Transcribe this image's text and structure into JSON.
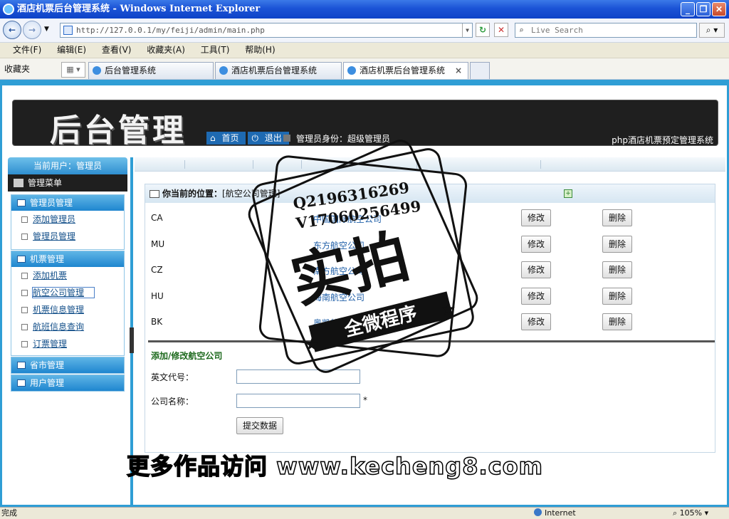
{
  "window": {
    "title": "酒店机票后台管理系统 - Windows Internet Explorer"
  },
  "address": {
    "url": "http://127.0.0.1/my/feiji/admin/main.php",
    "search_placeholder": "Live Search"
  },
  "menu": [
    "文件(F)",
    "编辑(E)",
    "查看(V)",
    "收藏夹(A)",
    "工具(T)",
    "帮助(H)"
  ],
  "favorites": {
    "label": "收藏夹"
  },
  "tabs": [
    {
      "label": "后台管理系统"
    },
    {
      "label": "酒店机票后台管理系统"
    },
    {
      "label": "酒店机票后台管理系统",
      "close": "×"
    }
  ],
  "banner": {
    "logo": "后台管理",
    "home": "首页",
    "logout": "退出",
    "admin_role": "管理员身份：超级管理员",
    "system_name": "php酒店机票预定管理系统"
  },
  "sidebar": {
    "current_user": "当前用户：管理员",
    "menu_title": "管理菜单",
    "groups": [
      {
        "title": "管理员管理",
        "items": [
          "添加管理员",
          "管理员管理"
        ]
      },
      {
        "title": "机票管理",
        "items": [
          "添加机票",
          "航空公司管理",
          "机票信息管理",
          "航班信息查询",
          "订票管理"
        ]
      },
      {
        "title": "省市管理",
        "items": []
      },
      {
        "title": "用户管理",
        "items": []
      }
    ]
  },
  "main": {
    "location_label": "你当前的位置：",
    "location_value": "[航空公司管理]",
    "airlines": [
      {
        "code": "CA",
        "name": "中国国际航空公司"
      },
      {
        "code": "MU",
        "name": "东方航空公司"
      },
      {
        "code": "CZ",
        "name": "南方航空公司"
      },
      {
        "code": "HU",
        "name": "海南航空公司"
      },
      {
        "code": "BK",
        "name": "奥凯航空公司"
      }
    ],
    "edit_label": "修改",
    "delete_label": "删除",
    "form": {
      "title": "添加/修改航空公司",
      "code_label": "英文代号：",
      "name_label": "公司名称：",
      "required_mark": "*",
      "submit": "提交数据"
    }
  },
  "status": {
    "left": "完成",
    "zone": "Internet",
    "zoom": "105%"
  },
  "watermark": {
    "q": "Q2196316269",
    "v": "V17060256499",
    "big": "实拍",
    "ribbon": "全微程序",
    "bottom": "更多作品访问 www.kecheng8.com"
  }
}
